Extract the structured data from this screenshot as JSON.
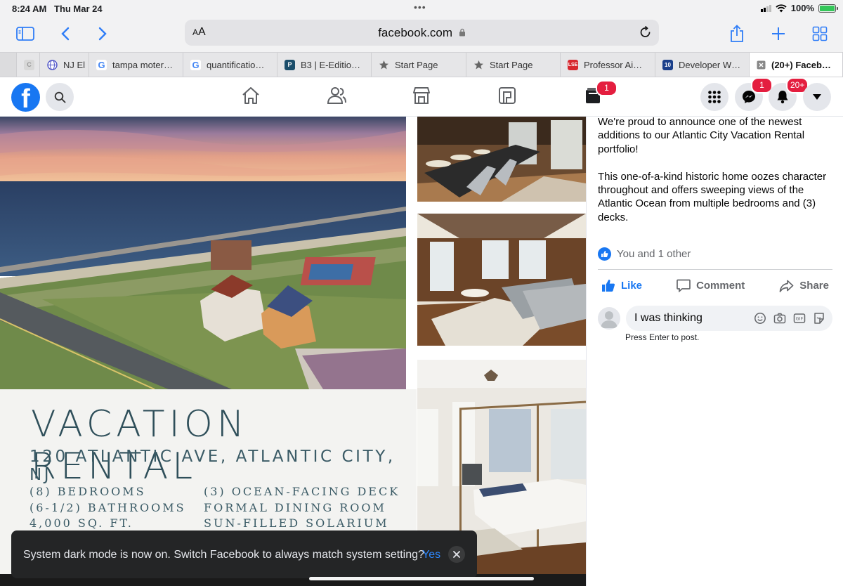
{
  "status": {
    "time": "8:24 AM",
    "date": "Thu Mar 24",
    "battery": "100%"
  },
  "browser": {
    "aa": "A",
    "aa_big": "A",
    "url": "facebook.com",
    "tabs": [
      {
        "label": "C",
        "favicon": "C",
        "color": "#bbbbbb"
      },
      {
        "label": "NJ El",
        "favicon": "globe",
        "color": "#5055c8"
      },
      {
        "label": "tampa moter…",
        "favicon": "G",
        "color": "#4285f4"
      },
      {
        "label": "quantificatio…",
        "favicon": "G",
        "color": "#4285f4"
      },
      {
        "label": "B3 | E-Editio…",
        "favicon": "P",
        "color": "#1b4e6b"
      },
      {
        "label": "Start Page",
        "favicon": "star",
        "color": "#666666"
      },
      {
        "label": "Start Page",
        "favicon": "star",
        "color": "#666666"
      },
      {
        "label": "Professor Ai…",
        "favicon": "LSE",
        "color": "#d7282f"
      },
      {
        "label": "Developer W…",
        "favicon": "10",
        "color": "#1a3f8a"
      },
      {
        "label": "(20+) Faceb…",
        "favicon": "close",
        "color": "#777777"
      }
    ]
  },
  "fb": {
    "logo": "f",
    "badges": {
      "marketplace": "1",
      "messenger": "1",
      "notifications": "20+"
    }
  },
  "flyer": {
    "title": "VACATION RENTAL",
    "address": "120 ATLANTIC AVE, ATLANTIC CITY, NJ",
    "features_left": [
      "(8) BEDROOMS",
      "(6-1/2) BATHROOMS",
      "4,000 SQ. FT."
    ],
    "features_right": [
      "(3) OCEAN-FACING DECK",
      "FORMAL DINING ROOM",
      "SUN-FILLED SOLARIUM"
    ]
  },
  "post": {
    "para1": "We're proud to announce one of the newest additions to our Atlantic City Vacation Rental portfolio!",
    "para2": "This one-of-a-kind historic home oozes character throughout and offers sweeping views of the Atlantic Ocean from multiple bedrooms and (3) decks.",
    "reactions": "You and 1 other",
    "like": "Like",
    "comment": "Comment",
    "share": "Share",
    "comment_value": "I was thinking",
    "hint": "Press Enter to post."
  },
  "toast": {
    "message": "System dark mode is now on. Switch Facebook to always match system setting?",
    "yes": "Yes"
  },
  "colors": {
    "fb_blue": "#1877f2",
    "safari_blue": "#2f7df7",
    "badge_red": "#e41e3f"
  }
}
